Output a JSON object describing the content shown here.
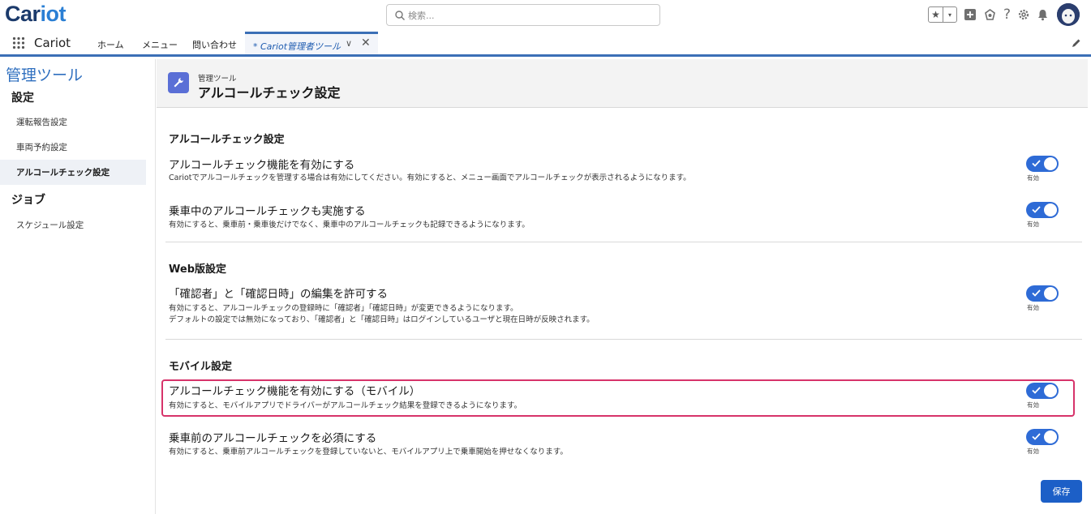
{
  "app": {
    "logo_left": "Car",
    "logo_right": "iot",
    "name": "Cariot"
  },
  "search": {
    "placeholder": "検索..."
  },
  "header_icons": [
    "star-icon",
    "chevron-down-icon",
    "add-icon",
    "setup-assistant-icon",
    "help-icon",
    "gear-icon",
    "bell-icon",
    "avatar"
  ],
  "nav": {
    "items": [
      "ホーム",
      "メニュー",
      "問い合わせ"
    ],
    "active_tab": {
      "label": "* Cariot管理者ツール",
      "chevron": "∨",
      "close": "✕"
    }
  },
  "sidebar": {
    "title": "管理ツール",
    "sections": [
      {
        "label": "設定",
        "items": [
          "運転報告設定",
          "車両予約設定",
          "アルコールチェック設定"
        ]
      },
      {
        "label": "ジョブ",
        "items": [
          "スケジュール設定"
        ]
      }
    ],
    "active_item": "アルコールチェック設定"
  },
  "page_header": {
    "subtitle": "管理ツール",
    "title": "アルコールチェック設定"
  },
  "sections": [
    {
      "title": "アルコールチェック設定",
      "settings": [
        {
          "label": "アルコールチェック機能を有効にする",
          "desc": [
            "Cariotでアルコールチェックを管理する場合は有効にしてください。有効にすると、メニュー画面でアルコールチェックが表示されるようになります。"
          ],
          "toggle_label": "有効",
          "enabled": true
        },
        {
          "label": "乗車中のアルコールチェックも実施する",
          "desc": [
            "有効にすると、乗車前・乗車後だけでなく、乗車中のアルコールチェックも記録できるようになります。"
          ],
          "toggle_label": "有効",
          "enabled": true
        }
      ]
    },
    {
      "title": "Web版設定",
      "settings": [
        {
          "label": "「確認者」と「確認日時」の編集を許可する",
          "desc": [
            "有効にすると、アルコールチェックの登録時に「確認者」「確認日時」が変更できるようになります。",
            "デフォルトの設定では無効になっており、「確認者」と「確認日時」はログインしているユーザと現在日時が反映されます。"
          ],
          "toggle_label": "有効",
          "enabled": true
        }
      ]
    },
    {
      "title": "モバイル設定",
      "settings": [
        {
          "label": "アルコールチェック機能を有効にする（モバイル）",
          "desc": [
            "有効にすると、モバイルアプリでドライバーがアルコールチェック結果を登録できるようになります。"
          ],
          "toggle_label": "有効",
          "enabled": true,
          "highlighted": true
        },
        {
          "label": "乗車前のアルコールチェックを必須にする",
          "desc": [
            "有効にすると、乗車前アルコールチェックを登録していないと、モバイルアプリ上で乗車開始を押せなくなります。"
          ],
          "toggle_label": "有効",
          "enabled": true
        }
      ]
    }
  ],
  "save_label": "保存",
  "colors": {
    "brand": "#1b3a6b",
    "accent": "#2e6bd6",
    "highlight": "#d7336a",
    "button": "#1c5fc7"
  }
}
